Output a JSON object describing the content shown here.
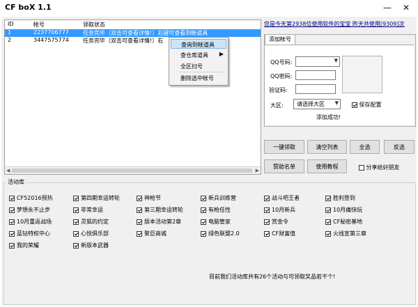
{
  "window": {
    "title": "CF boX 1.1",
    "minimize_label": "—",
    "close_label": "✕"
  },
  "table": {
    "columns": [
      "ID",
      "帐号",
      "领取状态"
    ],
    "rows": [
      {
        "id": "1",
        "account": "2237706777",
        "status": "任务完毕（双击可查看详情!）右键可查看到帐道具",
        "selected": true
      },
      {
        "id": "2",
        "account": "3447575774",
        "status": "任务完毕（双击可查看详情!）右",
        "selected": false
      }
    ]
  },
  "context_menu": {
    "items": [
      {
        "label": "查询到帐道具",
        "highlighted": true,
        "submenu": false
      },
      {
        "label": "查仓库道具",
        "highlighted": false,
        "submenu": true
      },
      {
        "label": "全区扫号",
        "highlighted": false,
        "submenu": false
      },
      {
        "label": "删除选中帐号",
        "highlighted": false,
        "submenu": false
      }
    ]
  },
  "info_text": "您是今天第2938位使用软件的宝宝 昨天共使用[9309]次",
  "add_account": {
    "tab_label": "添加帐号",
    "qq_label": "QQ号码:",
    "password_label": "QQ密码:",
    "captcha_label": "验证码:",
    "region_label": "大区:",
    "region_value": "请选择大区",
    "save_config_label": "保存配置",
    "save_config_checked": true,
    "status": "添加成功!"
  },
  "buttons": {
    "one_click": "一键领取",
    "clear_list": "清空列表",
    "select_all": "全选",
    "invert": "反选",
    "sponsor": "赞助名单",
    "tutorial": "使用教程",
    "share_label": "分享给好朋友",
    "share_checked": false
  },
  "activities": {
    "legend": "活动库",
    "items": [
      "CF52016预热",
      "第四期幸运转轮",
      "神枪节",
      "新兵训练营",
      "战斗吧王者",
      "胜利登到",
      "梦想永不止步",
      "非常幸运",
      "第三期幸运转轮",
      "有枪任性",
      "10月新兵",
      "10月痛快玩",
      "10月重返战场",
      "灵狐的约定",
      "版本活动第2章",
      "电脑管家",
      "赏金令",
      "CF秘密基地",
      "蓝钻特权中心",
      "心悦俱乐部",
      "聚巨商城",
      "绿色联盟2.0",
      "CF财富值",
      "火线宣第三章",
      "我的荣耀",
      "新版本武器"
    ]
  },
  "footer": "目前我们活动库共有26个活动与可领取奖品若干个!"
}
